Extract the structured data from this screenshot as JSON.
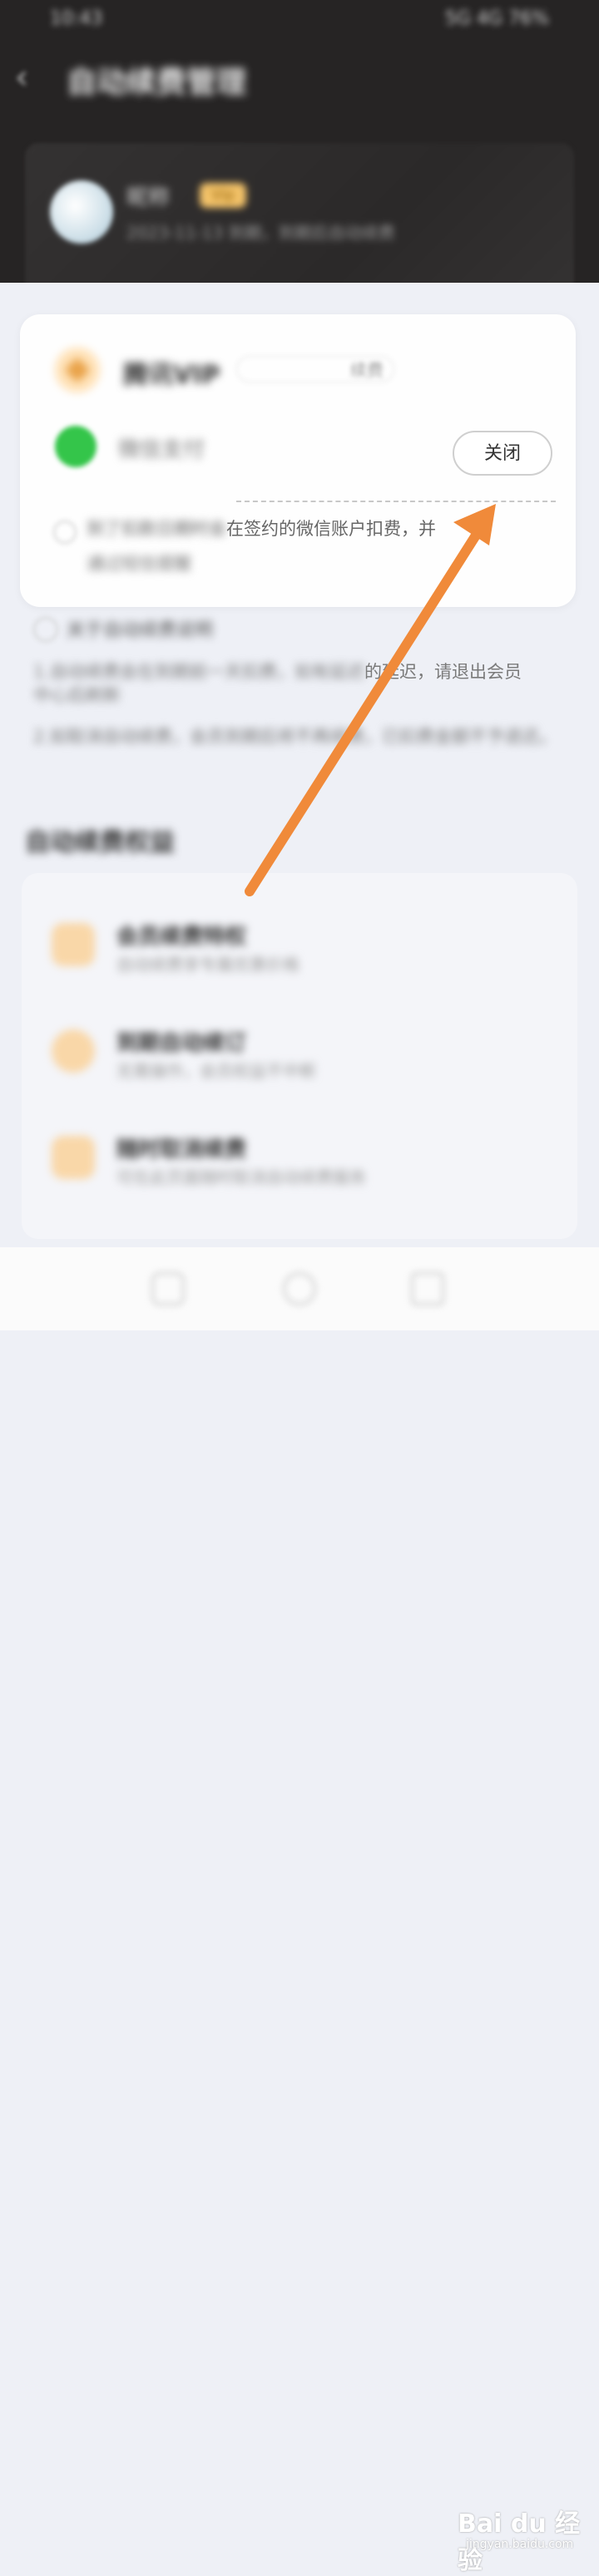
{
  "status_bar": {
    "time": "10:43",
    "right": "5G 4G 76%"
  },
  "header": {
    "title": "自动续费管理"
  },
  "member": {
    "nickname": "昵称",
    "vip_badge": "Vip",
    "expire_text": "2023-11-13 到期，到期后自动续费"
  },
  "service": {
    "product_name": "腾讯VIP",
    "price_label": "续费",
    "pay_method": "微信支付",
    "close_label": "关闭",
    "notice_blurred_prefix": "到了扣款日期时会",
    "notice_visible": "在签约的微信账户扣费，并",
    "notice_line2": "通过短信提醒"
  },
  "info": {
    "head": "关于自动续费说明",
    "item1_blurred": "1.自动续费会在到期前一天扣费，如有延迟",
    "item1_visible": "的延迟，请退出会员",
    "item1_cont": "中心后刷新",
    "item2": "2.如取消自动续费，会员到期后将不再续费，已扣费金额不予退还。"
  },
  "rights": {
    "title": "自动续费权益",
    "items": [
      {
        "title": "会员续费特权",
        "desc": "自动续费享专属优惠价格"
      },
      {
        "title": "到期自动续订",
        "desc": "无需操作，会员权益不中断"
      },
      {
        "title": "随时取消续费",
        "desc": "可在此页面随时取消自动续费服务"
      }
    ]
  },
  "watermark": {
    "brand": "Bai du 经验",
    "url": "jingyan.baidu.com"
  },
  "colors": {
    "accent_arrow": "#f08a3a",
    "header_bg": "#262424",
    "wechat_green": "#34c54a"
  }
}
